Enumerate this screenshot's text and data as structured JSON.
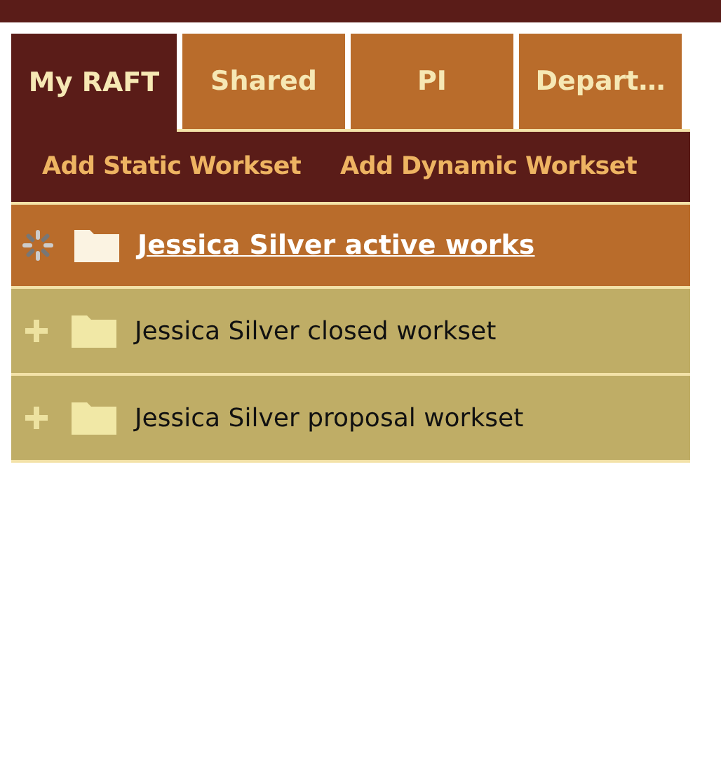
{
  "tabs": [
    {
      "label": "My RAFT",
      "selected": true
    },
    {
      "label": "Shared",
      "selected": false
    },
    {
      "label": "PI",
      "selected": false
    },
    {
      "label": "Depart…",
      "selected": false
    }
  ],
  "toolbar": {
    "links": [
      "Add Static Workset",
      "Add Dynamic Workset"
    ]
  },
  "worksets": [
    {
      "name": "Jessica Silver active works",
      "selected": true,
      "kind": "loading"
    },
    {
      "name": "Jessica Silver closed workset",
      "selected": false,
      "kind": "collapsed"
    },
    {
      "name": "Jessica Silver proposal workset",
      "selected": false,
      "kind": "collapsed"
    }
  ]
}
